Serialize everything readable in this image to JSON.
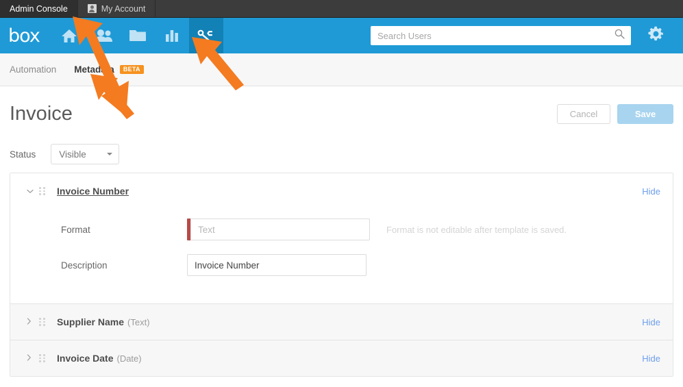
{
  "topbar": {
    "tabs": [
      {
        "label": "Admin Console",
        "active": true,
        "icon": null
      },
      {
        "label": "My Account",
        "active": false,
        "icon": "avatar-icon"
      }
    ]
  },
  "navbar": {
    "brand": "box",
    "icons": [
      {
        "name": "home-icon",
        "active": false
      },
      {
        "name": "users-icon",
        "active": false
      },
      {
        "name": "folder-icon",
        "active": false
      },
      {
        "name": "reports-bar-chart-icon",
        "active": false
      },
      {
        "name": "tools-wrench-icon",
        "active": true
      }
    ],
    "search": {
      "placeholder": "Search Users",
      "value": ""
    },
    "settings_icon": "gear-icon",
    "accent_color": "#1f9ad6",
    "active_color": "#1281b5"
  },
  "subnav": {
    "items": [
      {
        "label": "Automation",
        "active": false,
        "badge": null
      },
      {
        "label": "Metadata",
        "active": true,
        "badge": "BETA"
      }
    ],
    "badge_color": "#f6921e"
  },
  "page": {
    "title": "Invoice",
    "cancel_label": "Cancel",
    "save_label": "Save",
    "status_label": "Status",
    "status_value": "Visible"
  },
  "fields": [
    {
      "name": "Invoice Number",
      "type": null,
      "expanded": true,
      "hide_label": "Hide",
      "rows": [
        {
          "label": "Format",
          "value": "",
          "placeholder": "Text",
          "required_marker": true,
          "marker_color": "#b94a48",
          "hint": "Format is not editable after template is saved."
        },
        {
          "label": "Description",
          "value": "Invoice Number",
          "placeholder": "",
          "required_marker": false,
          "hint": ""
        }
      ]
    },
    {
      "name": "Supplier Name",
      "type": "(Text)",
      "expanded": false,
      "hide_label": "Hide",
      "rows": []
    },
    {
      "name": "Invoice Date",
      "type": "(Date)",
      "expanded": false,
      "hide_label": "Hide",
      "rows": []
    }
  ],
  "annotations": {
    "color": "#f47b20",
    "arrows": [
      {
        "name": "arrow-to-metadata-tab"
      },
      {
        "name": "arrow-to-tools-nav-icon"
      }
    ]
  }
}
